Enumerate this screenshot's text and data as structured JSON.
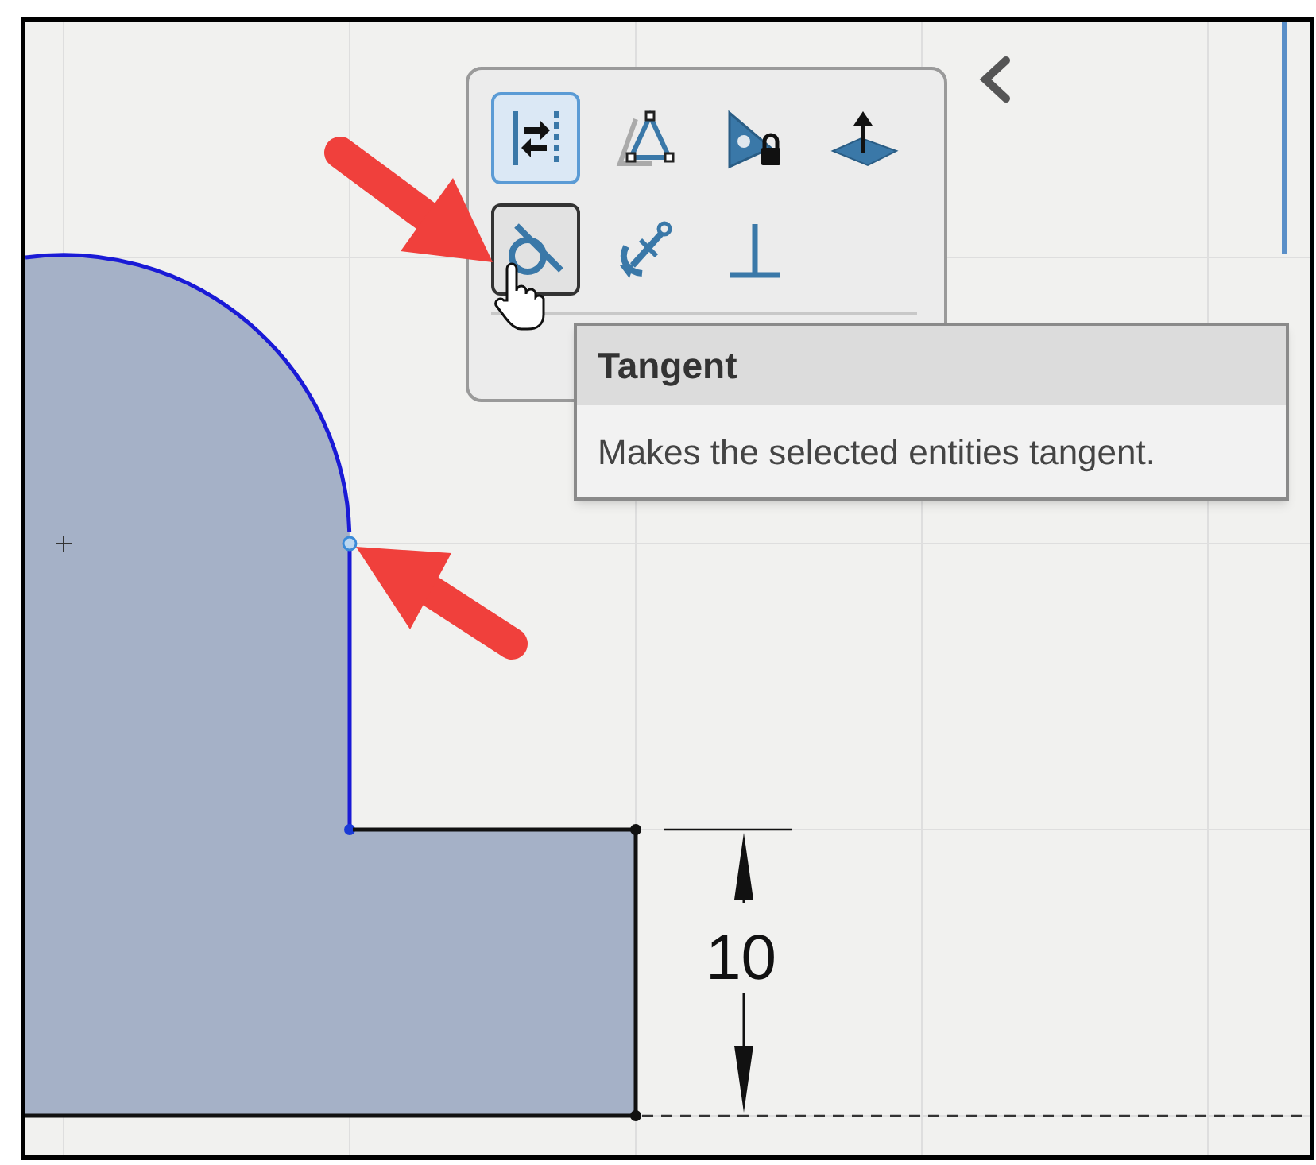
{
  "relations_toolbar": {
    "buttons": [
      {
        "selected": true,
        "hovered": false
      },
      {
        "selected": false,
        "hovered": false
      },
      {
        "selected": false,
        "hovered": false
      },
      {
        "selected": false,
        "hovered": false
      },
      {
        "selected": false,
        "hovered": true
      },
      {
        "selected": false,
        "hovered": false
      },
      {
        "selected": false,
        "hovered": false
      }
    ]
  },
  "tooltip": {
    "title": "Tangent",
    "description": "Makes the selected entities tangent."
  },
  "dimension": {
    "value": "10"
  }
}
